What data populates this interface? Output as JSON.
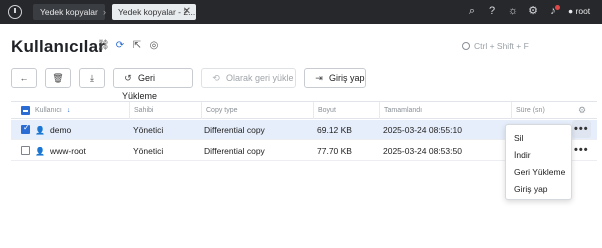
{
  "topbar": {
    "logo_icon": "app-logo-icon",
    "breadcrumb_1": "Yedek kopyalar",
    "breadcrumb_separator": "›",
    "breadcrumb_2": "Yedek kopyalar - 2...",
    "close_glyph": "✕",
    "icons": [
      "search-icon",
      "help-icon",
      "theme-icon",
      "settings-icon",
      "notifications-icon"
    ],
    "user": "root"
  },
  "header": {
    "title": "Kullanıcılar",
    "icons": [
      "link-icon",
      "sync-icon",
      "export-icon",
      "globe-icon"
    ],
    "search_placeholder": "Ctrl + Shift + F"
  },
  "toolbar": {
    "back_icon": "back-arrow-icon",
    "delete_icon": "trash-icon",
    "download_icon": "download-icon",
    "restore_label": "Geri Yükleme",
    "restore_as_label": "Olarak geri yükle",
    "login_label": "Giriş yap"
  },
  "table": {
    "columns": [
      "Kullanıcı",
      "Sahibi",
      "Copy type",
      "Boyut",
      "Tamamlandı",
      "Süre (sn)"
    ],
    "sort_indicator": "↓",
    "rows": [
      {
        "user": "demo",
        "owner": "Yönetici",
        "copy_type": "Differential copy",
        "size": "69.12 KB",
        "completed": "2025-03-24 08:55:10",
        "selected": true
      },
      {
        "user": "www-root",
        "owner": "Yönetici",
        "copy_type": "Differential copy",
        "size": "77.70 KB",
        "completed": "2025-03-24 08:53:50",
        "selected": false
      }
    ],
    "more_glyph": "•••"
  },
  "context_menu": {
    "items": [
      "Sil",
      "İndir",
      "Geri Yükleme",
      "Giriş yap"
    ]
  },
  "colors": {
    "accent": "#2b6cd4",
    "topbar_bg": "#26282c",
    "selected_row_bg": "#e6eefb"
  }
}
